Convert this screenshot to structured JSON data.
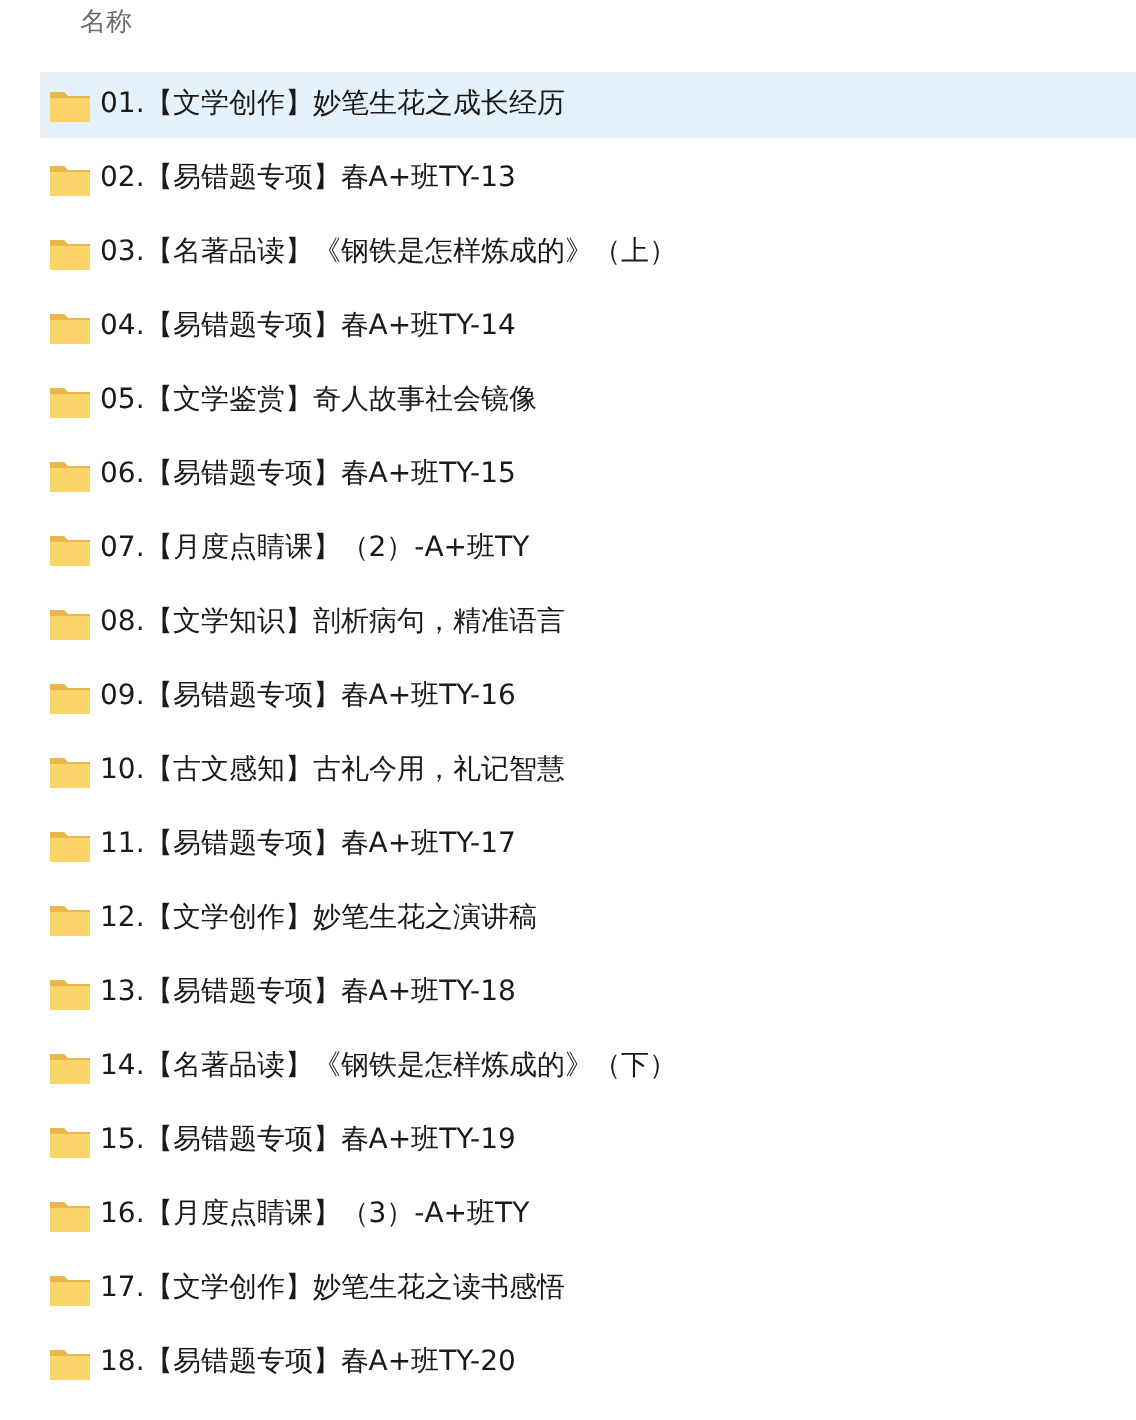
{
  "header": {
    "column_1": "名称"
  },
  "files": [
    {
      "name": "01.【文学创作】妙笔生花之成长经历",
      "selected": true
    },
    {
      "name": "02.【易错题专项】春A+班TY-13",
      "selected": false
    },
    {
      "name": "03.【名著品读】《钢铁是怎样炼成的》（上）",
      "selected": false
    },
    {
      "name": "04.【易错题专项】春A+班TY-14",
      "selected": false
    },
    {
      "name": "05.【文学鉴赏】奇人故事社会镜像",
      "selected": false
    },
    {
      "name": "06.【易错题专项】春A+班TY-15",
      "selected": false
    },
    {
      "name": "07.【月度点睛课】（2）-A+班TY",
      "selected": false
    },
    {
      "name": "08.【文学知识】剖析病句，精准语言",
      "selected": false
    },
    {
      "name": "09.【易错题专项】春A+班TY-16",
      "selected": false
    },
    {
      "name": "10.【古文感知】古礼今用，礼记智慧",
      "selected": false
    },
    {
      "name": "11.【易错题专项】春A+班TY-17",
      "selected": false
    },
    {
      "name": "12.【文学创作】妙笔生花之演讲稿",
      "selected": false
    },
    {
      "name": "13.【易错题专项】春A+班TY-18",
      "selected": false
    },
    {
      "name": "14.【名著品读】《钢铁是怎样炼成的》（下）",
      "selected": false
    },
    {
      "name": "15.【易错题专项】春A+班TY-19",
      "selected": false
    },
    {
      "name": "16.【月度点睛课】（3）-A+班TY",
      "selected": false
    },
    {
      "name": "17.【文学创作】妙笔生花之读书感悟",
      "selected": false
    },
    {
      "name": "18.【易错题专项】春A+班TY-20",
      "selected": false
    }
  ]
}
